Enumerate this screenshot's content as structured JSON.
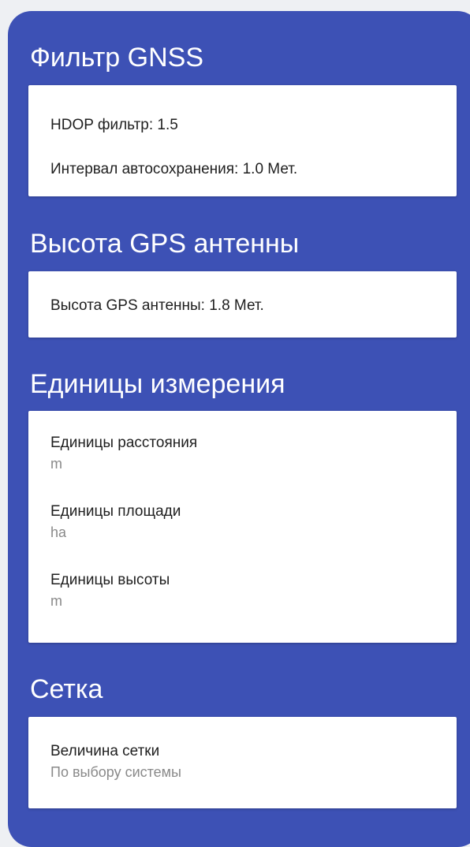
{
  "colors": {
    "panel_background": "#3d51b5",
    "card_background": "#ffffff",
    "primary_text": "#1f1f1f",
    "secondary_text": "#8a8a8a"
  },
  "gnss_filter": {
    "header": "Фильтр GNSS",
    "hdop_filter": "HDOP фильтр: 1.5",
    "autosave_interval": "Интервал автосохранения: 1.0 Мет."
  },
  "gps_antenna": {
    "header": "Высота GPS антенны",
    "antenna_height": "Высота GPS антенны: 1.8 Мет."
  },
  "units": {
    "header": "Единицы измерения",
    "distance": {
      "title": "Единицы расстояния",
      "value": "m"
    },
    "area": {
      "title": "Единицы площади",
      "value": "ha"
    },
    "height": {
      "title": "Единицы высоты",
      "value": "m"
    }
  },
  "grid": {
    "header": "Сетка",
    "grid_size": {
      "title": "Величина сетки",
      "value": "По выбору системы"
    }
  }
}
